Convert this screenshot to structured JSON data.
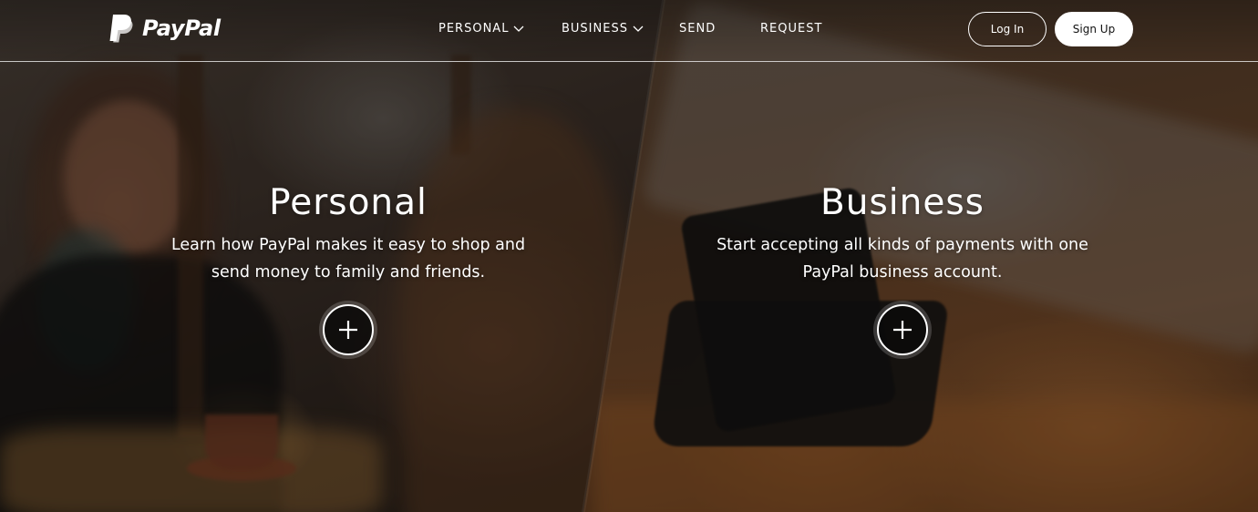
{
  "brand": {
    "name": "PayPal"
  },
  "nav": {
    "items": [
      {
        "label": "PERSONAL",
        "has_dropdown": true
      },
      {
        "label": "BUSINESS",
        "has_dropdown": true
      },
      {
        "label": "SEND",
        "has_dropdown": false
      },
      {
        "label": "REQUEST",
        "has_dropdown": false
      }
    ]
  },
  "auth": {
    "login_label": "Log In",
    "signup_label": "Sign Up"
  },
  "hero": {
    "personal": {
      "title": "Personal",
      "description": "Learn how PayPal makes it easy to shop and send money to family and friends.",
      "expand_icon": "plus-icon"
    },
    "business": {
      "title": "Business",
      "description": "Start accepting all kinds of payments with one PayPal business account.",
      "expand_icon": "plus-icon"
    }
  },
  "colors": {
    "text": "#ffffff",
    "header_rule": "#ffffff",
    "signup_bg": "#ffffff",
    "signup_text": "#111111"
  }
}
